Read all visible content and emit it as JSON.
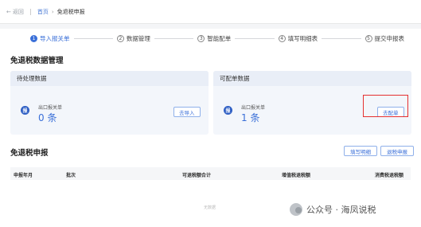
{
  "breadcrumb": {
    "back": "返回",
    "home": "首页",
    "current": "免退税申报"
  },
  "steps": [
    {
      "num": "1",
      "label": "导入报关单"
    },
    {
      "num": "2",
      "label": "数据管理"
    },
    {
      "num": "3",
      "label": "智能配单"
    },
    {
      "num": "4",
      "label": "填写明细表"
    },
    {
      "num": "5",
      "label": "提交申报表"
    }
  ],
  "data_section": {
    "title": "免退税数据管理"
  },
  "cards": [
    {
      "title": "待处理数据",
      "icon": "报",
      "label": "出口报关单",
      "count": "0 条",
      "button": "去导入"
    },
    {
      "title": "可配单数据",
      "icon": "报",
      "label": "出口报关单",
      "count": "1 条",
      "button": "去配单"
    }
  ],
  "declaration": {
    "title": "免退税申报",
    "btn_fill": "填写明细",
    "btn_refund": "退税申报",
    "columns": [
      "申报年月",
      "批次",
      "可退税额合计",
      "增值税退税额",
      "消费税退税额"
    ],
    "empty_text": "无数据"
  },
  "watermark": "公众号 · 海凤说税",
  "colors": {
    "accent": "#3a6fd8",
    "highlight": "#e53030"
  }
}
